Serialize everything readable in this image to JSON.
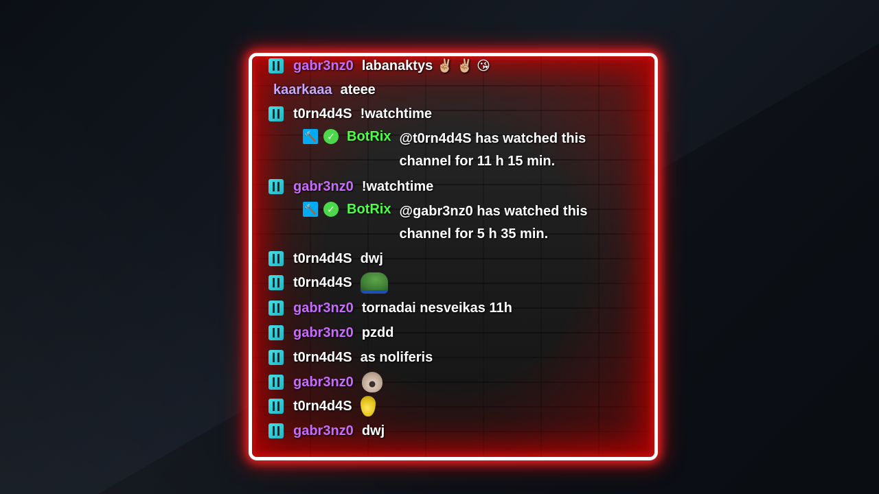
{
  "chat": {
    "messages": [
      {
        "user": "gabr3nz0",
        "text": "labanaktys",
        "emotes": "✌🏼 ✌🏼 😘"
      },
      {
        "user": "kaarkaaa",
        "text": "ateee"
      },
      {
        "user": "t0rn4d4S",
        "text": "!watchtime"
      },
      {
        "user": "BotRix",
        "line1": "@t0rn4d4S has watched this",
        "line2": "channel for 11 h 15 min."
      },
      {
        "user": "gabr3nz0",
        "text": "!watchtime"
      },
      {
        "user": "BotRix",
        "line1": "@gabr3nz0 has watched this",
        "line2": "channel for 5 h 35 min."
      },
      {
        "user": "t0rn4d4S",
        "text": "dwj"
      },
      {
        "user": "t0rn4d4S",
        "emote": "pepe-emote"
      },
      {
        "user": "gabr3nz0",
        "text": "tornadai nesveikas 11h"
      },
      {
        "user": "gabr3nz0",
        "text": "pzdd"
      },
      {
        "user": "t0rn4d4S",
        "text": "as noliferis"
      },
      {
        "user": "gabr3nz0",
        "emote": "cat-emote"
      },
      {
        "user": "t0rn4d4S",
        "emote": "pear-emote"
      },
      {
        "user": "gabr3nz0",
        "text": "dwj"
      }
    ]
  },
  "icons": {
    "sub_badge": "subscriber-badge-icon",
    "mod_badge": "moderator-badge-icon",
    "verified_badge": "verified-badge-icon"
  },
  "colors": {
    "frame_border": "#ffffff",
    "glow": "#ff2020",
    "user_pink": "#c86bff",
    "user_lavender": "#c6a8ff",
    "bot_green": "#4cff46",
    "badge_cyan": "#43e0e6",
    "mod_blue": "#00aaf5"
  }
}
